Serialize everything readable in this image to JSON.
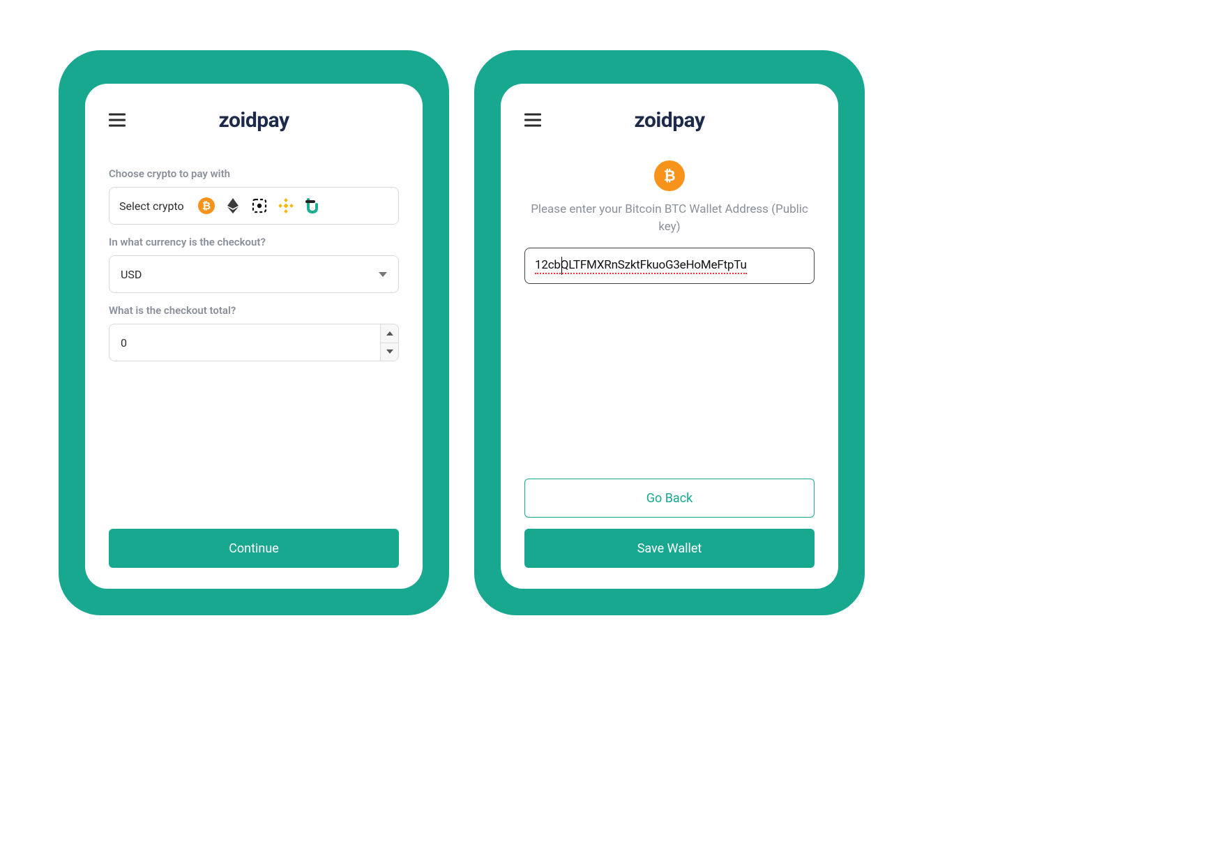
{
  "brand": "zoidpay",
  "left": {
    "labels": {
      "choose_crypto": "Choose crypto to pay with",
      "currency_q": "In what currency is the checkout?",
      "total_q": "What is the checkout total?"
    },
    "crypto_placeholder": "Select crypto",
    "currency_value": "USD",
    "total_value": "0",
    "continue_label": "Continue"
  },
  "right": {
    "instruction": "Please enter your Bitcoin BTC Wallet Address (Public key)",
    "address_value": "12cbQLTFMXRnSzktFkuoG3eHoMeFtpTu",
    "go_back_label": "Go Back",
    "save_label": "Save Wallet"
  },
  "colors": {
    "accent": "#18a890",
    "bitcoin": "#f7931a",
    "binance": "#f0b90b"
  }
}
